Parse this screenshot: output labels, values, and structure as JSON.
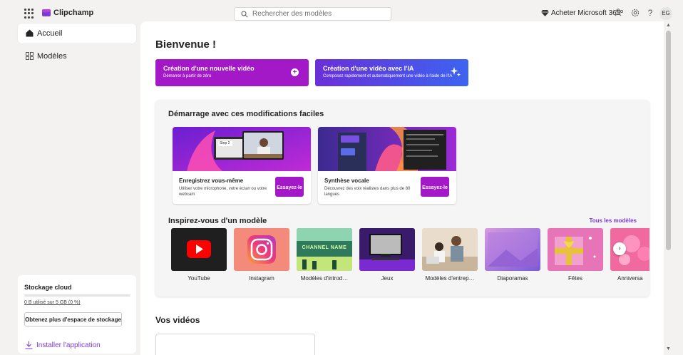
{
  "app": {
    "name": "Clipchamp"
  },
  "search": {
    "placeholder": "Rechercher des modèles"
  },
  "topbar": {
    "buy_label": "Acheter Microsoft 365",
    "avatar_initials": "EG",
    "help_label": "?"
  },
  "sidebar": {
    "items": [
      {
        "label": "Accueil",
        "icon": "home-icon",
        "active": true
      },
      {
        "label": "Modèles",
        "icon": "templates-grid-icon",
        "active": false
      }
    ],
    "storage": {
      "title": "Stockage cloud",
      "used_text": "0 B utilisé sur 5 GB (0 %)",
      "used_fraction": 0.0,
      "button_label": "Obtenez plus d'espace de stockage"
    },
    "install_label": "Installer l'application"
  },
  "main": {
    "welcome": "Bienvenue !",
    "cta": [
      {
        "title": "Création d'une nouvelle vidéo",
        "subtitle": "Démarrer à partir de zéro",
        "icon": "plus-icon"
      },
      {
        "title": "Création d'une vidéo avec l'IA",
        "subtitle": "Composez rapidement et automatiquement une vidéo à l'aide de l'IA",
        "icon": "sparkle-icon"
      }
    ],
    "easy_edits": {
      "title": "Démarrage avec ces modifications faciles",
      "cards": [
        {
          "title": "Enregistrez vous-même",
          "desc": "Utiliser votre microphone, votre écran ou votre webcam",
          "button": "Essayez-le",
          "thumb_badge": "Step 2"
        },
        {
          "title": "Synthèse vocale",
          "desc": "Découvrez des voix réalistes dans plus de 80 langues",
          "button": "Essayez-le"
        }
      ]
    },
    "inspire": {
      "title": "Inspirez-vous d'un modèle",
      "all_link": "Tous les modèles",
      "templates": [
        {
          "label": "YouTube"
        },
        {
          "label": "Instagram"
        },
        {
          "label": "Modèles d'introd…",
          "thumb_text": "CHANNEL NAME"
        },
        {
          "label": "Jeux"
        },
        {
          "label": "Modèles d'entrep…"
        },
        {
          "label": "Diaporamas"
        },
        {
          "label": "Fêtes"
        },
        {
          "label": "Anniversa"
        }
      ]
    },
    "videos_title": "Vos vidéos"
  },
  "colors": {
    "accent": "#7a3cd6",
    "cta_pink": "#a319c7",
    "cta_blue": "#4f59e8",
    "youtube_red": "#ff0000"
  }
}
